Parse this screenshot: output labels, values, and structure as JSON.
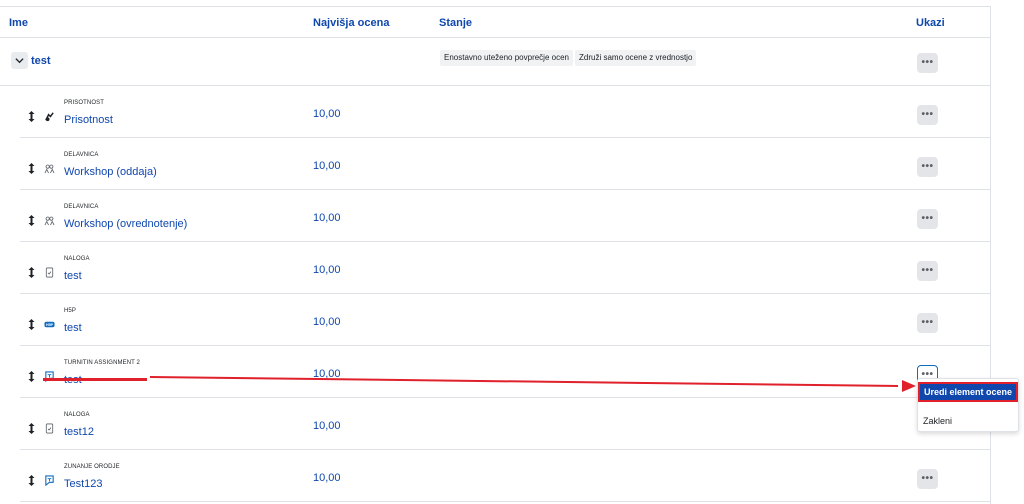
{
  "header": {
    "name": "Ime",
    "max_grade": "Najvišja ocena",
    "state": "Stanje",
    "actions": "Ukazi"
  },
  "category": {
    "name": "test",
    "aggregation": "Enostavno uteženo povprečje ocen",
    "aggregate_only": "Združi samo ocene z vrednostjo",
    "actions_icon": "more-icon"
  },
  "items": [
    {
      "type": "PRISOTNOST",
      "name": "Prisotnost",
      "max": "10,00",
      "icon": "attendance-icon"
    },
    {
      "type": "DELAVNICA",
      "name": "Workshop (oddaja)",
      "max": "10,00",
      "icon": "workshop-icon"
    },
    {
      "type": "DELAVNICA",
      "name": "Workshop (ovrednotenje)",
      "max": "10,00",
      "icon": "workshop-icon"
    },
    {
      "type": "NALOGA",
      "name": "test",
      "max": "10,00",
      "icon": "assignment-icon"
    },
    {
      "type": "H5P",
      "name": "test",
      "max": "10,00",
      "icon": "h5p-icon"
    },
    {
      "type": "TURNITIN ASSIGNMENT 2",
      "name": "test",
      "max": "10,00",
      "icon": "turnitin-icon"
    },
    {
      "type": "NALOGA",
      "name": "test12",
      "max": "10,00",
      "icon": "assignment-icon"
    },
    {
      "type": "ZUNANJE ORODJE",
      "name": "Test123",
      "max": "10,00",
      "icon": "external-tool-icon"
    }
  ],
  "menu": {
    "edit": "Uredi element ocene",
    "lock": "Zakleni"
  },
  "colors": {
    "link": "#0f47ad",
    "highlight": "#e0202a"
  }
}
